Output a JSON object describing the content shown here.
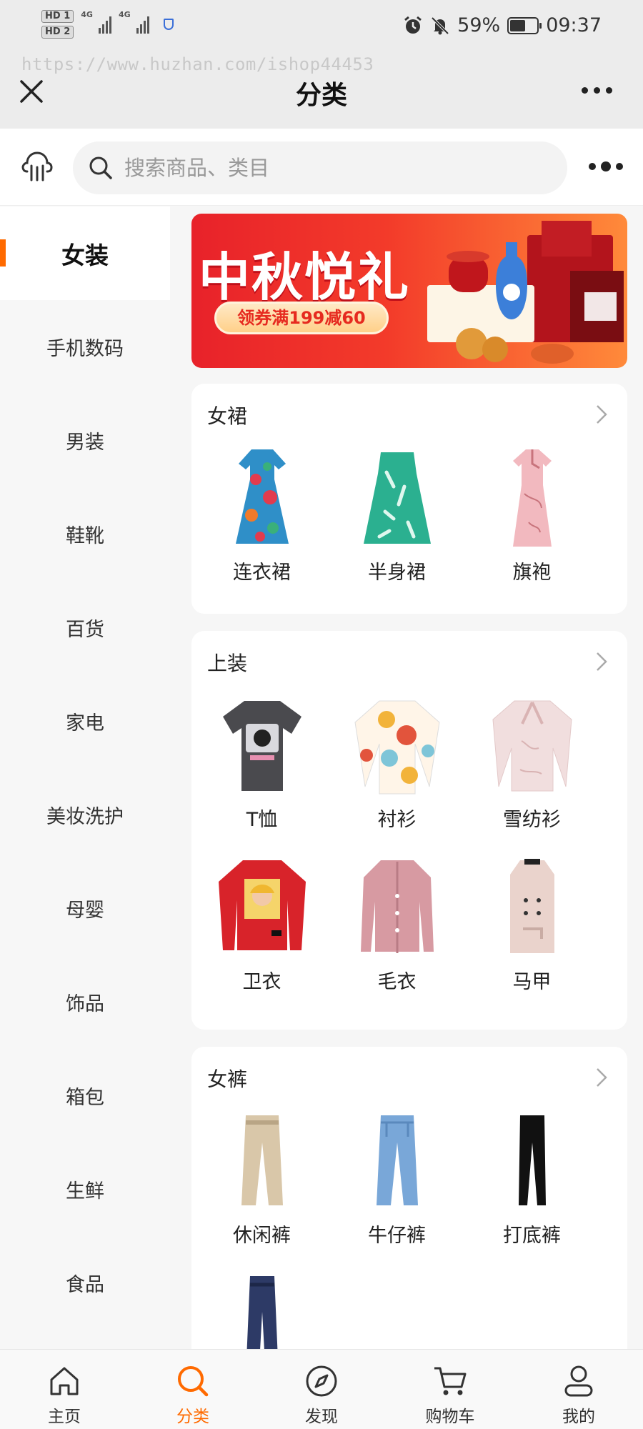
{
  "status_bar": {
    "hd1": "HD 1",
    "hd2": "HD 2",
    "net1": "4G",
    "net2": "4G",
    "battery": "59%",
    "battery_level": 0.59,
    "time": "09:37",
    "icons": [
      "alarm-icon",
      "mute-bell-icon",
      "battery-icon",
      "signal-icon",
      "shield-icon"
    ]
  },
  "watermark": "https://www.huzhan.com/ishop44453",
  "header": {
    "title": "分类"
  },
  "search": {
    "placeholder": "搜索商品、类目"
  },
  "sidebar": {
    "items": [
      {
        "label": "女装",
        "active": true
      },
      {
        "label": "手机数码"
      },
      {
        "label": "男装"
      },
      {
        "label": "鞋靴"
      },
      {
        "label": "百货"
      },
      {
        "label": "家电"
      },
      {
        "label": "美妆洗护"
      },
      {
        "label": "母婴"
      },
      {
        "label": "饰品"
      },
      {
        "label": "箱包"
      },
      {
        "label": "生鲜"
      },
      {
        "label": "食品"
      }
    ]
  },
  "banner": {
    "title": "中秋悦礼",
    "coupon": "领券满199减60"
  },
  "sections": [
    {
      "title": "女裙",
      "items": [
        {
          "label": "连衣裙",
          "icon": "floral-dress-icon"
        },
        {
          "label": "半身裙",
          "icon": "skirt-icon"
        },
        {
          "label": "旗袍",
          "icon": "qipao-icon"
        }
      ]
    },
    {
      "title": "上装",
      "items": [
        {
          "label": "T恤",
          "icon": "tshirt-icon"
        },
        {
          "label": "衬衫",
          "icon": "shirt-icon"
        },
        {
          "label": "雪纺衫",
          "icon": "chiffon-blouse-icon"
        },
        {
          "label": "卫衣",
          "icon": "sweatshirt-icon"
        },
        {
          "label": "毛衣",
          "icon": "cardigan-icon"
        },
        {
          "label": "马甲",
          "icon": "vest-icon"
        }
      ]
    },
    {
      "title": "女裤",
      "items": [
        {
          "label": "休闲裤",
          "icon": "casual-pants-icon"
        },
        {
          "label": "牛仔裤",
          "icon": "jeans-icon"
        },
        {
          "label": "打底裤",
          "icon": "leggings-icon"
        },
        {
          "label": "",
          "icon": "trousers-icon"
        }
      ]
    }
  ],
  "bottom_nav": [
    {
      "label": "主页",
      "icon": "home-icon"
    },
    {
      "label": "分类",
      "icon": "search-icon",
      "active": true
    },
    {
      "label": "发现",
      "icon": "compass-icon"
    },
    {
      "label": "购物车",
      "icon": "cart-icon"
    },
    {
      "label": "我的",
      "icon": "user-icon"
    }
  ],
  "colors": {
    "accent": "#ff6a00",
    "banner_red": "#e8222a"
  }
}
